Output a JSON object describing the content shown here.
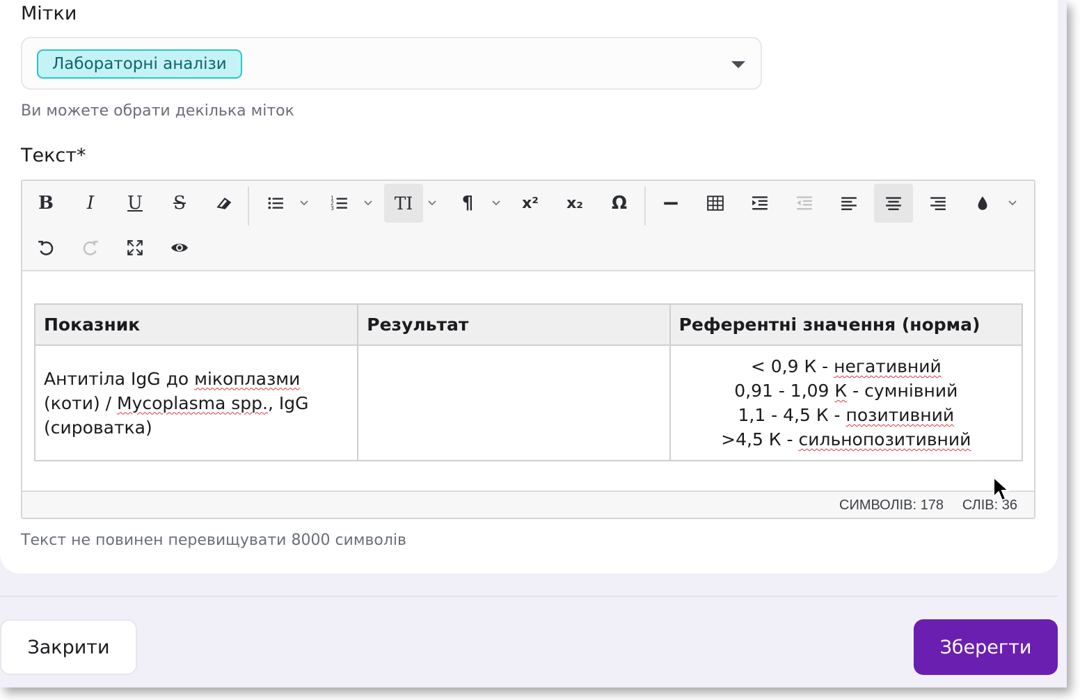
{
  "tags": {
    "label": "Мітки",
    "selected": [
      "Лабораторні аналізи"
    ],
    "hint": "Ви можете обрати декілька міток"
  },
  "text_field": {
    "label": "Текст*",
    "hint": "Текст не повинен перевищувати 8000 символів",
    "toolbar": {
      "row1": [
        "bold-icon",
        "italic-icon",
        "underline-icon",
        "strikethrough-icon",
        "eraser-icon",
        "bulleted-list-icon",
        "numbered-list-icon",
        "text-size-icon",
        "paragraph-icon",
        "superscript-icon",
        "subscript-icon",
        "special-char-icon",
        "horizontal-rule-icon",
        "table-icon",
        "indent-icon",
        "outdent-icon",
        "align-left-icon",
        "align-center-icon",
        "align-right-icon",
        "color-icon"
      ],
      "row2": [
        "undo-icon",
        "redo-icon",
        "fullscreen-icon",
        "preview-icon"
      ],
      "labels": {
        "bold": "B",
        "italic": "I",
        "underline": "U",
        "strike": "S",
        "superscript": "x²",
        "subscript": "x₂",
        "omega": "Ω",
        "paragraph": "¶",
        "text_size": "TI"
      }
    },
    "table": {
      "headers": [
        "Показник",
        "Результат",
        "Референтні значення (норма)"
      ],
      "row": {
        "indicator": [
          "Антитіла IgG до ",
          "мікоплазми",
          " (коти) / ",
          "Mycoplasma spp.",
          ", IgG (сироватка)"
        ],
        "result": "",
        "reference": [
          [
            "< 0,9 К - ",
            "негативний"
          ],
          [
            "0,91 - 1,09 ",
            "К",
            " - сумнівний"
          ],
          [
            "1,1 - 4,5 К - ",
            "позитивний"
          ],
          [
            ">4,5 К - ",
            "сильнопозитивний"
          ]
        ]
      }
    },
    "status": {
      "chars": "СИМВОЛІВ: 178",
      "words": "СЛІВ: 36"
    }
  },
  "actions": {
    "close": "Закрити",
    "save": "Зберегти"
  }
}
